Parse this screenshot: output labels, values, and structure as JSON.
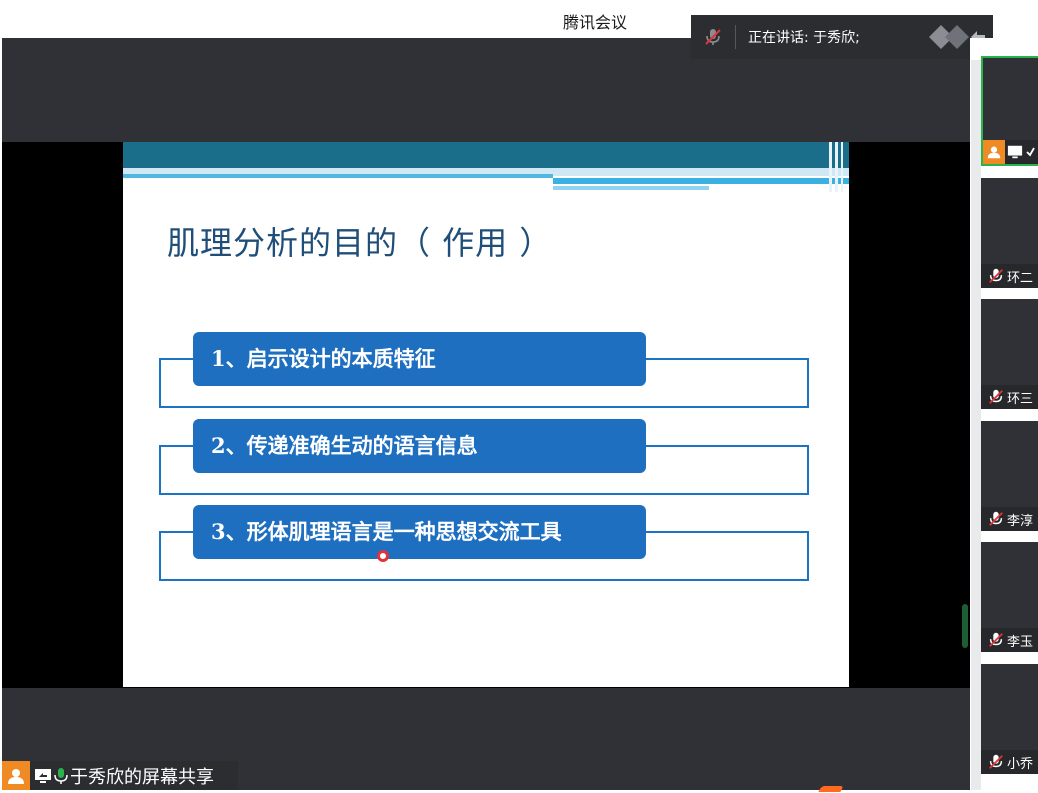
{
  "window": {
    "title": "腾讯会议"
  },
  "speaker_bar": {
    "text": "正在讲话: 于秀欣;"
  },
  "slide": {
    "title": "肌理分析的目的（ 作用 ）",
    "items": [
      {
        "label": "1、启示设计的本质特征"
      },
      {
        "label": "2、传递准确生动的语言信息"
      },
      {
        "label": "3、形体肌理语言是一种思想交流工具"
      }
    ]
  },
  "share": {
    "label": "于秀欣的屏幕共享"
  },
  "participants": [
    {
      "name": "环二"
    },
    {
      "name": "环三"
    },
    {
      "name": "李淳"
    },
    {
      "name": "李玉"
    },
    {
      "name": "小乔"
    }
  ],
  "colors": {
    "accent_green": "#2ab24c",
    "avatar_orange": "#f08a24",
    "slide_blue": "#1f6fc1",
    "title_blue": "#1f4e79",
    "muted_red": "#e0343b"
  },
  "icons": [
    "mic-muted-icon",
    "avatar-icon",
    "screen-share-icon",
    "mic-icon",
    "arrows-icon",
    "collapse-icon"
  ]
}
